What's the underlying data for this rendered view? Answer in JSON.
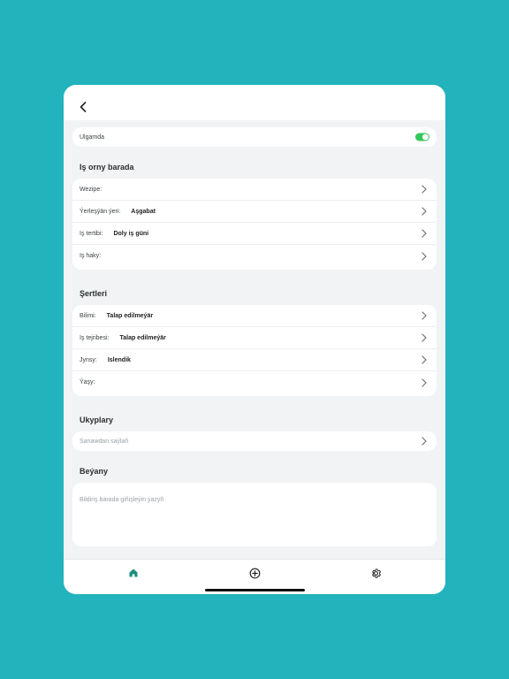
{
  "colors": {
    "background": "#22b3bd",
    "accent": "#1e8e7e",
    "toggle_on": "#34c759"
  },
  "header": {
    "back_icon": "chevron-left-icon"
  },
  "online": {
    "label": "Ulgamda",
    "enabled": true
  },
  "job_section": {
    "title": "Iş orny barada",
    "rows": [
      {
        "label": "Wezipe:",
        "value": ""
      },
      {
        "label": "Ýerleşýän ýeri:",
        "value": "Aşgabat"
      },
      {
        "label": "Iş tertibi:",
        "value": "Doly iş güni"
      },
      {
        "label": "Iş haky:",
        "value": ""
      }
    ]
  },
  "conditions_section": {
    "title": "Şertleri",
    "rows": [
      {
        "label": "Bilimi:",
        "value": "Talap edilmeýär"
      },
      {
        "label": "Iş tejribesi:",
        "value": "Talap edilmeýär"
      },
      {
        "label": "Jynsy:",
        "value": "Islendik"
      },
      {
        "label": "Ýaşy:",
        "value": ""
      }
    ]
  },
  "skills_section": {
    "title": "Ukyplary",
    "placeholder": "Sanawdan saýlaň"
  },
  "statement_section": {
    "title": "Beýany",
    "placeholder": "Bildiriş barada giňişleýin ýazyň"
  },
  "bottom_nav": {
    "tabs": [
      {
        "icon": "home-icon",
        "active": true
      },
      {
        "icon": "add-circle-icon",
        "active": false
      },
      {
        "icon": "gear-icon",
        "active": false
      }
    ]
  }
}
